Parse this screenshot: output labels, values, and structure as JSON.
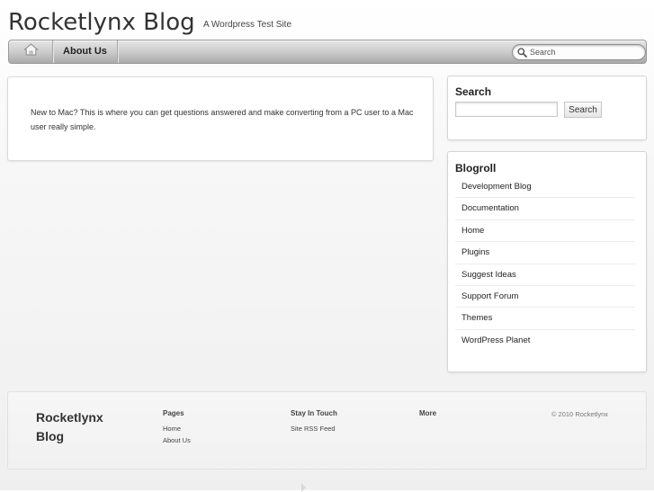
{
  "header": {
    "site_title": "Rocketlynx Blog",
    "tagline": "A Wordpress Test Site"
  },
  "nav": {
    "home_icon": "home-icon",
    "about_label": "About Us",
    "search_placeholder": "Search",
    "search_icon": "magnifier-icon"
  },
  "main": {
    "text": "New to Mac? This is where you can get questions answered and make converting from a PC user to a Mac user really simple."
  },
  "sidebar": {
    "search": {
      "title": "Search",
      "input_value": "",
      "button_label": "Search"
    },
    "blogroll": {
      "title": "Blogroll",
      "links": [
        "Development Blog",
        "Documentation",
        "Home",
        "Plugins",
        "Suggest Ideas",
        "Support Forum",
        "Themes",
        "WordPress Planet"
      ]
    }
  },
  "footer": {
    "title": "Rocketlynx Blog",
    "pages": {
      "heading": "Pages",
      "links": [
        "Home",
        "About Us"
      ]
    },
    "stay_in_touch": {
      "heading": "Stay In Touch",
      "links": [
        "Site RSS Feed"
      ]
    },
    "more": {
      "heading": "More"
    },
    "copyright": "© 2010 Rocketlynx"
  },
  "colors": {
    "nav_gradient_top": "#e6e6e6",
    "nav_gradient_bottom": "#a9a9a9",
    "text": "#333333",
    "box_border": "#dadada"
  }
}
